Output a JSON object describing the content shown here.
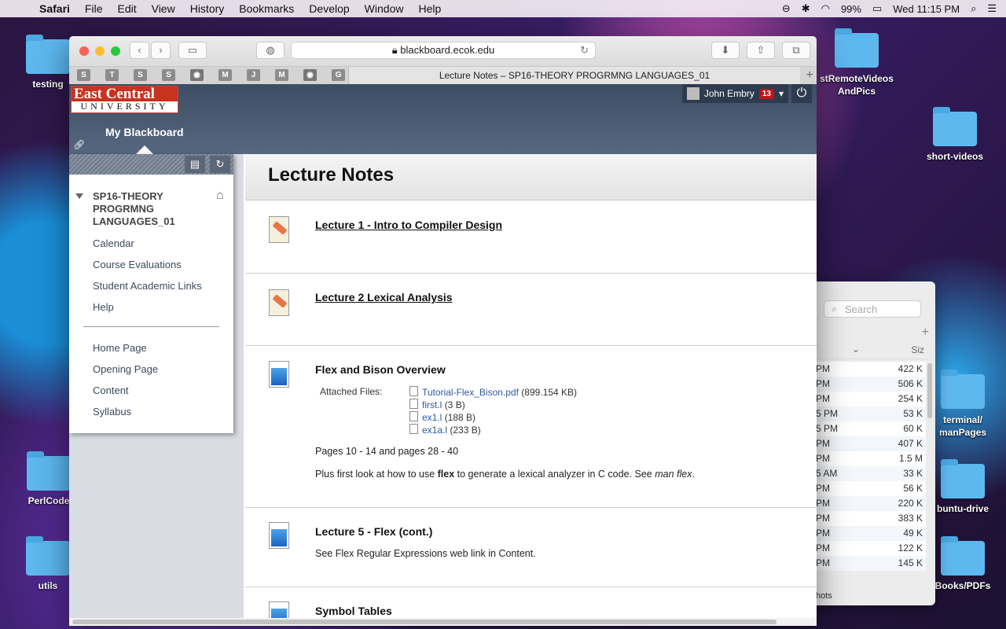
{
  "menubar": {
    "app": "Safari",
    "items": [
      "File",
      "Edit",
      "View",
      "History",
      "Bookmarks",
      "Develop",
      "Window",
      "Help"
    ],
    "battery": "99%",
    "clock": "Wed 11:15 PM"
  },
  "desktop": {
    "icons": [
      "testing",
      "stRemoteVideos\nAndPics",
      "short-videos",
      "PerlCode",
      "utils",
      "terminal/\nmanPages",
      "buntu-drive",
      "Books/PDFs"
    ]
  },
  "finder": {
    "search_placeholder": "Search",
    "size_header": "Siz",
    "rows": [
      {
        "d": "PM",
        "s": "422 K"
      },
      {
        "d": "PM",
        "s": "506 K"
      },
      {
        "d": "PM",
        "s": "254 K"
      },
      {
        "d": "5 PM",
        "s": "53 K"
      },
      {
        "d": "5 PM",
        "s": "60 K"
      },
      {
        "d": "PM",
        "s": "407 K"
      },
      {
        "d": "PM",
        "s": "1.5 M"
      },
      {
        "d": "5 AM",
        "s": "33 K"
      },
      {
        "d": "PM",
        "s": "56 K"
      },
      {
        "d": "PM",
        "s": "220 K"
      },
      {
        "d": "PM",
        "s": "383 K"
      },
      {
        "d": "PM",
        "s": "49 K"
      },
      {
        "d": "PM",
        "s": "122 K"
      },
      {
        "d": "PM",
        "s": "145 K"
      }
    ],
    "footer": "hots"
  },
  "browser": {
    "url": "blackboard.ecok.edu",
    "favicons": [
      "S",
      "T",
      "S",
      "S",
      "",
      "M",
      "J",
      "M",
      "",
      "G"
    ],
    "tab_title": "Lecture Notes – SP16-THEORY PROGRMNG LANGUAGES_01"
  },
  "bb": {
    "logo_top": "East Central",
    "logo_bottom": "UNIVERSITY",
    "user_name": "John Embry",
    "notif_count": "13",
    "my_blackboard": "My Blackboard"
  },
  "sidebar": {
    "course": "SP16-THEORY PROGRMNG LANGUAGES_01",
    "links1": [
      "Calendar",
      "Course Evaluations",
      "Student Academic Links",
      "Help"
    ],
    "links2": [
      "Home Page",
      "Opening Page",
      "Content",
      "Syllabus"
    ]
  },
  "content": {
    "title": "Lecture Notes",
    "items": [
      {
        "title": "Lecture 1 - Intro to Compiler Design"
      },
      {
        "title": "Lecture 2 Lexical Analysis"
      },
      {
        "title": "Flex and Bison Overview",
        "attached_label": "Attached Files:",
        "files": [
          {
            "name": "Tutorial-Flex_Bison.pdf",
            "size": "(899.154 KB)"
          },
          {
            "name": "first.l",
            "size": "(3 B)"
          },
          {
            "name": "ex1.l",
            "size": "(188 B)"
          },
          {
            "name": "ex1a.l",
            "size": "(233 B)"
          }
        ],
        "pages": "Pages 10 - 14 and pages 28 - 40",
        "desc_pre": "Plus first look at how to use ",
        "desc_bold": "flex",
        "desc_mid": " to generate a lexical analyzer in C code. See ",
        "desc_em": "man flex",
        "desc_post": "."
      },
      {
        "title": "Lecture 5 - Flex (cont.)",
        "desc": "See Flex Regular Expressions web link in Content."
      },
      {
        "title": "Symbol Tables"
      }
    ]
  }
}
